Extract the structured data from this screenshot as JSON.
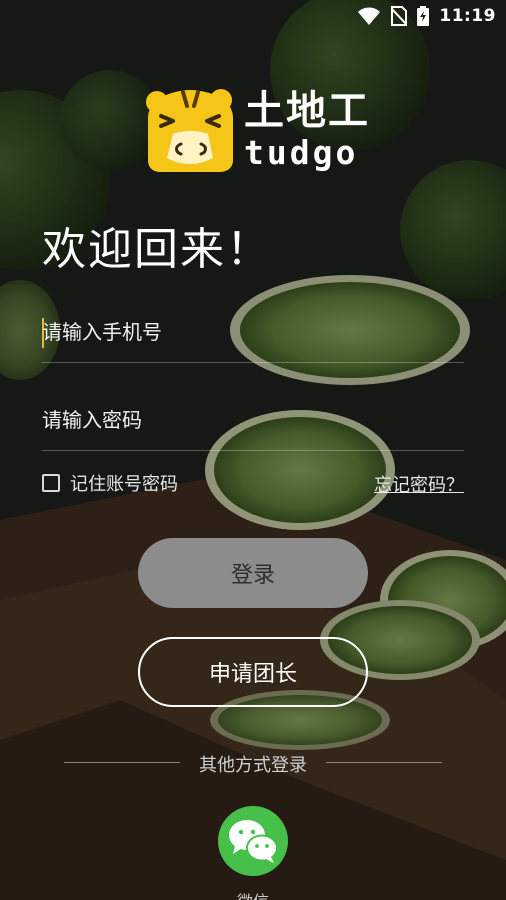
{
  "status_bar": {
    "time": "11:19",
    "icons": [
      "wifi-icon",
      "no-sim-icon",
      "battery-charging-icon"
    ]
  },
  "brand": {
    "name": "土地工",
    "latin": "tudgo",
    "mascot": "hamster-logo-icon",
    "accent_color": "#f5c518"
  },
  "welcome_title": "欢迎回来！",
  "form": {
    "phone_placeholder": "请输入手机号",
    "password_placeholder": "请输入密码",
    "remember_label": "记住账号密码",
    "forgot_label": "忘记密码？"
  },
  "buttons": {
    "login_label": "登录",
    "apply_label": "申请团长"
  },
  "other_login": {
    "divider_label": "其他方式登录",
    "wechat_label": "微信",
    "wechat_icon": "wechat-icon",
    "wechat_color": "#46c04a"
  }
}
